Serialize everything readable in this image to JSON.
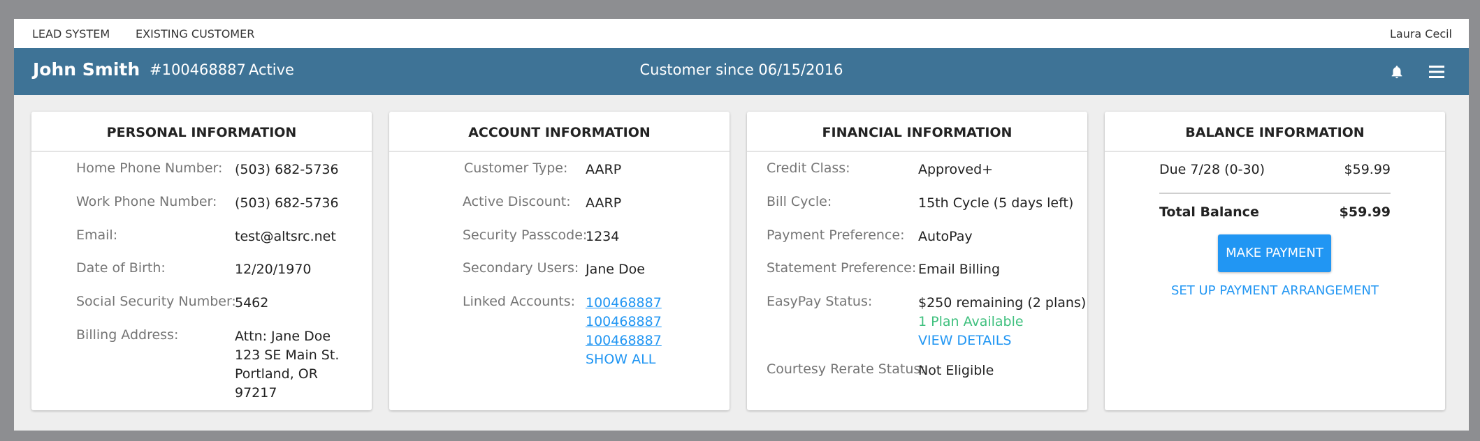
{
  "topnav": {
    "items": [
      "LEAD SYSTEM",
      "EXISTING CUSTOMER"
    ],
    "user": "Laura Cecil"
  },
  "header": {
    "name": "John Smith",
    "account": "#100468887",
    "status": "Active",
    "since": "Customer since 06/15/2016",
    "icons": [
      "bell-icon",
      "menu-icon"
    ],
    "bg_color": "#3e7396"
  },
  "personal": {
    "title": "PERSONAL INFORMATION",
    "rows": [
      {
        "label": "Home Phone Number:",
        "value": "(503) 682-5736"
      },
      {
        "label": "Work Phone Number:",
        "value": "(503) 682-5736"
      },
      {
        "label": "Email:",
        "value": "test@altsrc.net"
      },
      {
        "label": "Date of Birth:",
        "value": "12/20/1970"
      },
      {
        "label": "Social Security Number:",
        "value": "5462"
      }
    ],
    "billing": {
      "label": "Billing Address:",
      "lines": [
        "Attn: Jane Doe",
        "123 SE Main St.",
        "Portland, OR",
        "97217"
      ]
    }
  },
  "account": {
    "title": "ACCOUNT INFORMATION",
    "rows": [
      {
        "label": "Customer Type:",
        "value": "AARP"
      },
      {
        "label": "Active Discount:",
        "value": "AARP"
      },
      {
        "label": "Security Passcode:",
        "value": "1234"
      },
      {
        "label": "Secondary Users:",
        "value": "Jane Doe"
      }
    ],
    "linked": {
      "label": "Linked Accounts:",
      "accounts": [
        "100468887",
        "100468887",
        "100468887"
      ],
      "show_all": "SHOW ALL"
    }
  },
  "financial": {
    "title": "FINANCIAL INFORMATION",
    "rows": [
      {
        "label": "Credit Class:",
        "value": "Approved+"
      },
      {
        "label": "Bill Cycle:",
        "value": "15th Cycle (5 days left)"
      },
      {
        "label": "Payment Preference:",
        "value": "AutoPay"
      },
      {
        "label": "Statement Preference:",
        "value": "Email Billing"
      }
    ],
    "easypay": {
      "label": "EasyPay Status:",
      "value": "$250 remaining (2 plans)",
      "plans": "1 Plan Available",
      "details": "VIEW DETAILS"
    },
    "courtesy": {
      "label": "Courtesy Rerate Status:",
      "value": "Not Eligible"
    }
  },
  "balance": {
    "title": "BALANCE INFORMATION",
    "due_label": "Due 7/28 (0-30)",
    "due_value": "$59.99",
    "total_label": "Total Balance",
    "total_value": "$59.99",
    "pay_button": "MAKE PAYMENT",
    "arrangement": "SET UP PAYMENT ARRANGEMENT"
  },
  "colors": {
    "accent": "#2196f3",
    "success": "#3fc07e",
    "background": "#eeeeee"
  }
}
